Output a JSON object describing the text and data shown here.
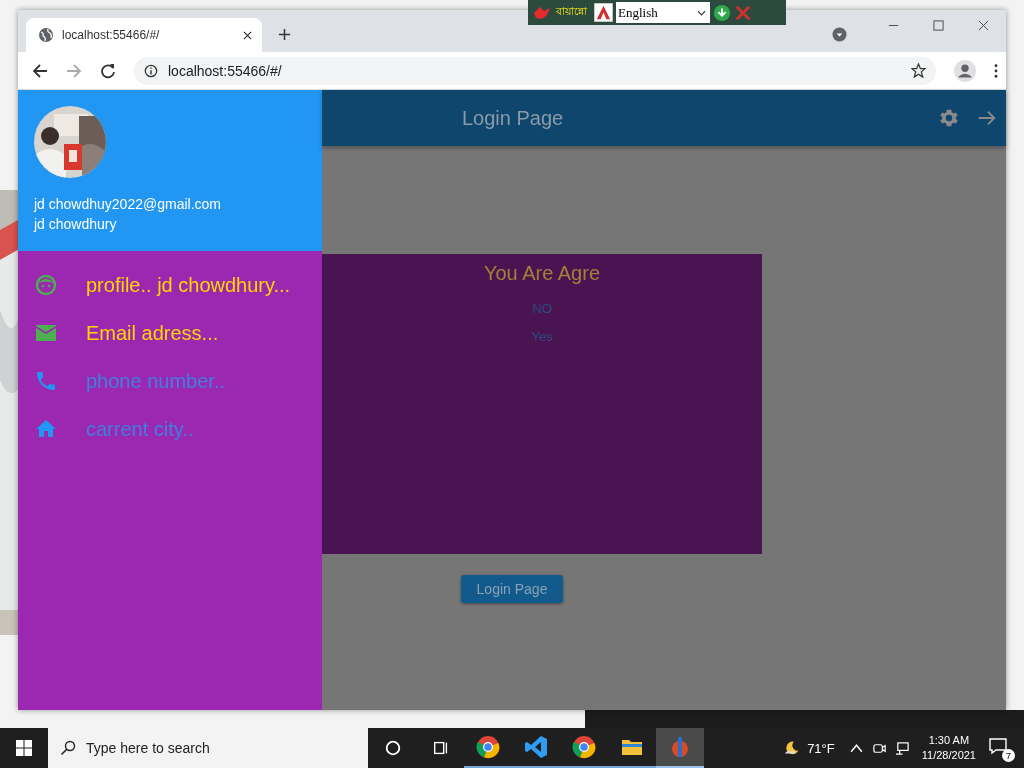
{
  "language_bar": {
    "script_text": "বায়ান্নো",
    "language": "English"
  },
  "browser": {
    "tab_title": "localhost:55466/#/",
    "address": "localhost:55466/#/"
  },
  "app_bar": {
    "title": "Login Page"
  },
  "drawer": {
    "email": "jd chowdhuy2022@gmail.com",
    "name": "jd chowdhury",
    "items": [
      {
        "kind": "face",
        "label": "profile.. jd chowdhury...",
        "color": "#4caf50",
        "highlighted": true
      },
      {
        "kind": "mail",
        "label": "Email adress...",
        "color": "#4caf50",
        "highlighted": true
      },
      {
        "kind": "phone",
        "label": "phone number..",
        "color": "#2196f3",
        "highlighted": false
      },
      {
        "kind": "home",
        "label": "carrent city..",
        "color": "#2196f3",
        "highlighted": false
      }
    ]
  },
  "dialog": {
    "title": "You Are Agre",
    "options": [
      "NO",
      "Yes"
    ]
  },
  "button": "Login Page",
  "taskbar": {
    "search_placeholder": "Type here to search",
    "apps": [
      {
        "kind": "chrome",
        "selected": false
      },
      {
        "kind": "vscode",
        "selected": false
      },
      {
        "kind": "chrome",
        "selected": false
      },
      {
        "kind": "folder",
        "selected": false
      },
      {
        "kind": "app",
        "selected": true
      }
    ],
    "weather": "71°F",
    "time": "1:30 AM",
    "date": "11/28/2021",
    "notifications": "7"
  }
}
